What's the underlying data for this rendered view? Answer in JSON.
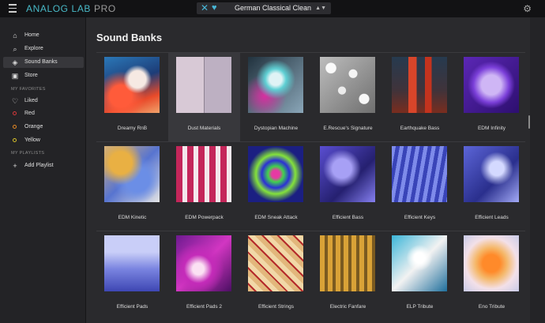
{
  "app": {
    "brand": "ANALOG LAB",
    "brand_suffix": "PRO",
    "preset_name": "German Classical Clean",
    "icons": {
      "menu": "hamburger-icon",
      "close": "close-icon",
      "favorite": "heart-icon",
      "arrows": "up-down-arrows-icon",
      "settings": "gear-icon"
    },
    "accent": "#48b9c7"
  },
  "sidebar": {
    "items": [
      {
        "label": "Home",
        "icon": "home-icon"
      },
      {
        "label": "Explore",
        "icon": "search-icon"
      },
      {
        "label": "Sound Banks",
        "icon": "layers-icon"
      },
      {
        "label": "Store",
        "icon": "store-icon"
      }
    ],
    "favorites_heading": "MY FAVORITES",
    "favorites": [
      {
        "label": "Liked",
        "icon": "heart-icon"
      },
      {
        "label": "Red",
        "color": "#d7383a"
      },
      {
        "label": "Orange",
        "color": "#e58a24"
      },
      {
        "label": "Yellow",
        "color": "#d8c22a"
      }
    ],
    "playlists_heading": "MY PLAYLISTS",
    "add_playlist": {
      "label": "Add Playlist",
      "icon": "plus-icon"
    }
  },
  "main": {
    "title": "Sound Banks",
    "banks": [
      {
        "name": "Dreamy RnB"
      },
      {
        "name": "Dust Materials"
      },
      {
        "name": "Dystopian Machine"
      },
      {
        "name": "E.Rescue's Signature"
      },
      {
        "name": "Earthquake Bass"
      },
      {
        "name": "EDM Infinity"
      },
      {
        "name": "EDM Kinetic"
      },
      {
        "name": "EDM Powerpack"
      },
      {
        "name": "EDM Sneak Attack"
      },
      {
        "name": "Efficient Bass"
      },
      {
        "name": "Efficient Keys"
      },
      {
        "name": "Efficient Leads"
      },
      {
        "name": "Efficient Pads"
      },
      {
        "name": "Efficient Pads 2"
      },
      {
        "name": "Efficient Strings"
      },
      {
        "name": "Electric Fanfare"
      },
      {
        "name": "ELP Tribute"
      },
      {
        "name": "Eno Tribute"
      }
    ]
  }
}
